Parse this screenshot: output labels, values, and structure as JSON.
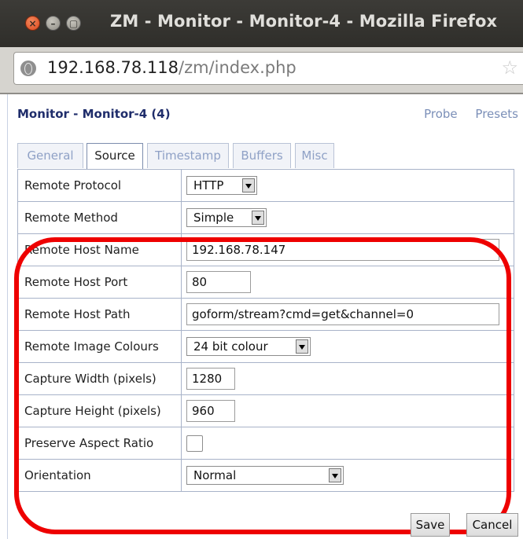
{
  "window": {
    "title": "ZM - Monitor - Monitor-4 - Mozilla Firefox",
    "close_glyph": "×",
    "min_glyph": "–",
    "max_glyph": "▢"
  },
  "urlbar": {
    "host": "192.168.78.118",
    "path": "/zm/index.php",
    "star_icon": "star-icon"
  },
  "page": {
    "heading": "Monitor - Monitor-4 (4)",
    "links": [
      "Probe",
      "Presets"
    ]
  },
  "tabs": [
    {
      "label": "General",
      "active": false
    },
    {
      "label": "Source",
      "active": true
    },
    {
      "label": "Timestamp",
      "active": false
    },
    {
      "label": "Buffers",
      "active": false
    },
    {
      "label": "Misc",
      "active": false
    }
  ],
  "rows": [
    {
      "label": "Remote Protocol",
      "type": "select",
      "value": "HTTP"
    },
    {
      "label": "Remote Method",
      "type": "select",
      "value": "Simple"
    },
    {
      "label": "Remote Host Name",
      "type": "input",
      "value": "192.168.78.147"
    },
    {
      "label": "Remote Host Port",
      "type": "input",
      "value": "80"
    },
    {
      "label": "Remote Host Path",
      "type": "input",
      "value": "goform/stream?cmd=get&channel=0"
    },
    {
      "label": "Remote Image Colours",
      "type": "select",
      "value": "24 bit colour"
    },
    {
      "label": "Capture Width (pixels)",
      "type": "input",
      "value": "1280"
    },
    {
      "label": "Capture Height (pixels)",
      "type": "input",
      "value": "960"
    },
    {
      "label": "Preserve Aspect Ratio",
      "type": "checkbox",
      "checked": false
    },
    {
      "label": "Orientation",
      "type": "select",
      "value": "Normal"
    }
  ],
  "buttons": {
    "save": "Save",
    "cancel": "Cancel"
  },
  "colors": {
    "annotation": "#ee0000",
    "heading": "#1f2d6b",
    "link": "#7b8fb8"
  }
}
